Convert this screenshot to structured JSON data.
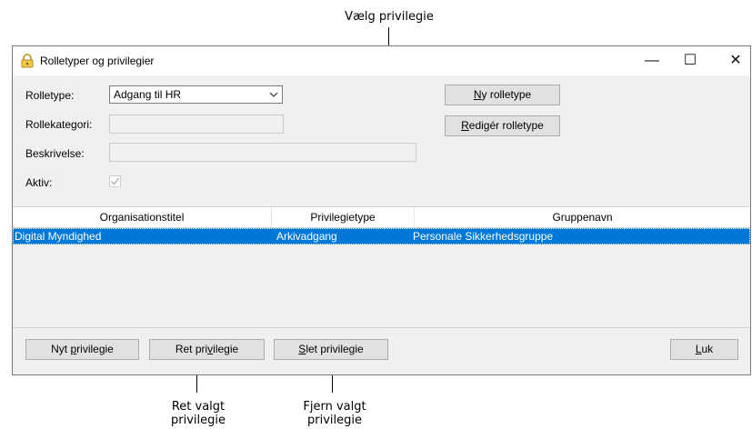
{
  "annotations": {
    "top": "Vælg privilegie",
    "bottom_left": "Ret valgt privilegie",
    "bottom_right": "Fjern valgt privilegie"
  },
  "window": {
    "title": "Rolletyper og privilegier",
    "controls": {
      "minimize": "—",
      "maximize": "☐",
      "close": "✕"
    }
  },
  "form": {
    "rolletype_label": "Rolletype:",
    "rolletype_value": "Adgang til HR",
    "rollekategori_label": "Rollekategori:",
    "rollekategori_value": "",
    "beskrivelse_label": "Beskrivelse:",
    "beskrivelse_value": "",
    "aktiv_label": "Aktiv:",
    "aktiv_checked": true
  },
  "buttons": {
    "ny_rolletype": {
      "pre": "",
      "key": "N",
      "post": "y rolletype"
    },
    "rediger_rolletype": {
      "pre": "",
      "key": "R",
      "post": "edigér rolletype"
    },
    "nyt_privilegie": {
      "pre": "Nyt ",
      "key": "p",
      "post": "rivilegie"
    },
    "ret_privilegie": {
      "pre": "Ret pri",
      "key": "v",
      "post": "ilegie"
    },
    "slet_privilegie": {
      "pre": "",
      "key": "S",
      "post": "let privilegie"
    },
    "luk": {
      "pre": "",
      "key": "L",
      "post": "uk"
    }
  },
  "table": {
    "columns": [
      "Organisationstitel",
      "Privilegietype",
      "Gruppenavn"
    ],
    "rows": [
      [
        "Digital Myndighed",
        "Arkivadgang",
        "Personale Sikkerhedsgruppe"
      ]
    ],
    "selected_row": 0
  },
  "colors": {
    "selection": "#0078d7",
    "window_bg": "#f0f0f0"
  }
}
